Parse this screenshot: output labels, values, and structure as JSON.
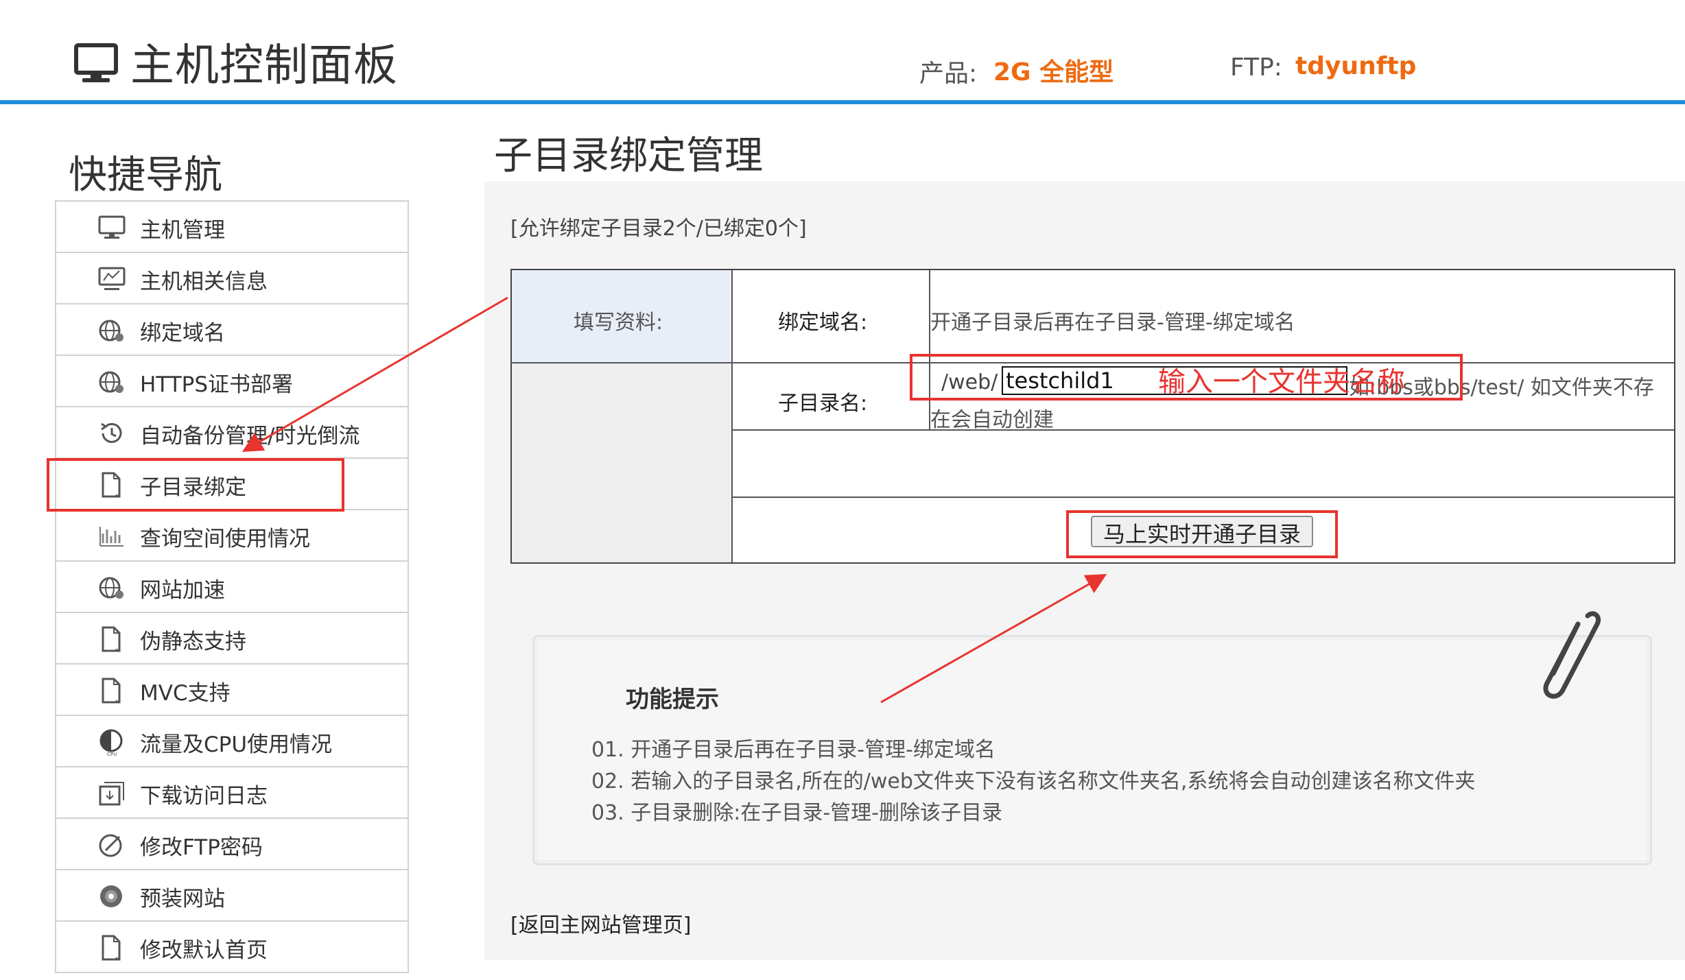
{
  "header": {
    "title": "主机控制面板",
    "product_label": "产品:",
    "product_value": "2G 全能型",
    "ftp_label": "FTP:",
    "ftp_value": "tdyunftp"
  },
  "sidebar": {
    "title": "快捷导航",
    "items": [
      {
        "label": "主机管理",
        "icon": "monitor-icon"
      },
      {
        "label": "主机相关信息",
        "icon": "monitor-info-icon"
      },
      {
        "label": "绑定域名",
        "icon": "globe-icon"
      },
      {
        "label": "HTTPS证书部署",
        "icon": "globe-icon"
      },
      {
        "label": "自动备份管理/时光倒流",
        "icon": "history-icon"
      },
      {
        "label": "子目录绑定",
        "icon": "document-icon"
      },
      {
        "label": "查询空间使用情况",
        "icon": "chart-icon"
      },
      {
        "label": "网站加速",
        "icon": "globe-icon"
      },
      {
        "label": "伪静态支持",
        "icon": "document-icon"
      },
      {
        "label": "MVC支持",
        "icon": "document-icon"
      },
      {
        "label": "流量及CPU使用情况",
        "icon": "cpu-icon"
      },
      {
        "label": "下载访问日志",
        "icon": "download-icon"
      },
      {
        "label": "修改FTP密码",
        "icon": "edit-icon"
      },
      {
        "label": "预装网站",
        "icon": "disc-icon"
      },
      {
        "label": "修改默认首页",
        "icon": "document-icon"
      }
    ]
  },
  "main": {
    "title": "子目录绑定管理",
    "quota": "[允许绑定子目录2个/已绑定0个]",
    "form": {
      "fill_label": "填写资料:",
      "domain_label": "绑定域名:",
      "domain_hint": "开通子目录后再在子目录-管理-绑定域名",
      "subdir_label": "子目录名:",
      "prefix": "/web/",
      "subdir_value": "testchild1",
      "subdir_hint_line1": "如:bbs或bbs/test/ 如文件夹不存",
      "subdir_hint_line2": "在会自动创建",
      "submit_label": "马上实时开通子目录"
    },
    "tips": {
      "title": "功能提示",
      "items": [
        "01. 开通子目录后再在子目录-管理-绑定域名",
        "02. 若输入的子目录名,所在的/web文件夹下没有该名称文件夹名,系统将会自动创建该名称文件夹",
        "03. 子目录删除:在子目录-管理-删除该子目录"
      ]
    },
    "back_link": "[返回主网站管理页]"
  },
  "annotation": {
    "text": "输入一个文件夹名称",
    "color": "#e8332f"
  },
  "colors": {
    "accent": "#1e8ddb",
    "highlight": "#ee6a10"
  }
}
